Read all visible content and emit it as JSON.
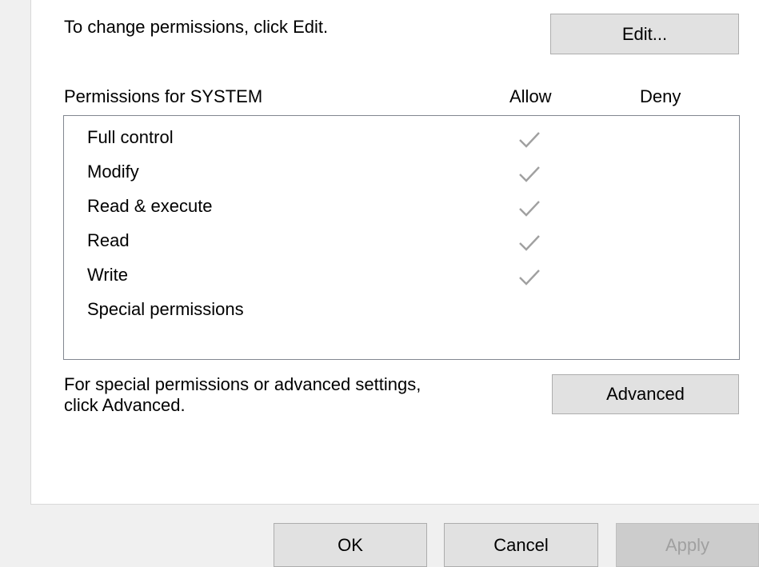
{
  "security_tab": {
    "edit_prompt": "To change permissions, click Edit.",
    "edit_button": "Edit...",
    "permissions_header": "Permissions for SYSTEM",
    "col_allow": "Allow",
    "col_deny": "Deny",
    "permissions": [
      {
        "name": "Full control",
        "allow": true,
        "deny": false
      },
      {
        "name": "Modify",
        "allow": true,
        "deny": false
      },
      {
        "name": "Read & execute",
        "allow": true,
        "deny": false
      },
      {
        "name": "Read",
        "allow": true,
        "deny": false
      },
      {
        "name": "Write",
        "allow": true,
        "deny": false
      },
      {
        "name": "Special permissions",
        "allow": false,
        "deny": false
      }
    ],
    "advanced_prompt_line1": "For special permissions or advanced settings,",
    "advanced_prompt_line2": "click Advanced.",
    "advanced_button": "Advanced"
  },
  "dialog_buttons": {
    "ok": "OK",
    "cancel": "Cancel",
    "apply": "Apply",
    "apply_disabled": true
  },
  "colors": {
    "checkmark": "#a0a0a0",
    "button_face": "#e1e1e1",
    "dialog_bg": "#f0f0f0"
  }
}
